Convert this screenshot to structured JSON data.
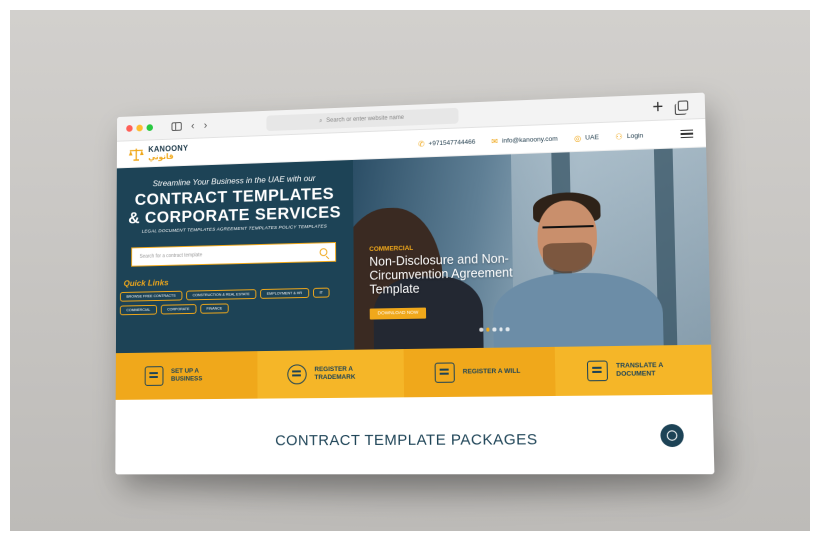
{
  "browser": {
    "address_placeholder": "Search or enter website name",
    "dot_colors": [
      "#ff5f57",
      "#febc2e",
      "#28c840"
    ]
  },
  "header": {
    "logo_en": "KANOONY",
    "logo_ar": "قانوني",
    "phone": "+971547744466",
    "email": "info@kanoony.com",
    "region": "UAE",
    "login": "Login"
  },
  "hero": {
    "subtitle": "Streamline Your Business in the UAE with our",
    "title_line1": "CONTRACT TEMPLATES",
    "title_line2": "& CORPORATE SERVICES",
    "tags": "LEGAL DOCUMENT TEMPLATES   AGREEMENT TEMPLATES   POLICY TEMPLATES",
    "search_placeholder": "Search for a contract template",
    "quick_links_title": "Quick Links",
    "quick_links": [
      "BROWSE FREE CONTRACTS",
      "CONSTRUCTION & REAL ESTATE",
      "EMPLOYMENT & HR",
      "IT",
      "COMMERCIAL",
      "CORPORATE",
      "FINANCE"
    ],
    "slide_tag": "COMMERCIAL",
    "slide_title": "Non-Disclosure and Non-Circumvention Agreement Template",
    "slide_button": "DOWNLOAD NOW"
  },
  "services": [
    {
      "label": "SET UP A BUSINESS",
      "icon": "business-icon"
    },
    {
      "label": "REGISTER A TRADEMARK",
      "icon": "trademark-icon"
    },
    {
      "label": "REGISTER A WILL",
      "icon": "will-icon"
    },
    {
      "label": "TRANSLATE A DOCUMENT",
      "icon": "translate-icon"
    }
  ],
  "packages": {
    "title": "CONTRACT TEMPLATE PACKAGES"
  },
  "colors": {
    "navy": "#1d4356",
    "accent": "#f0a81b"
  }
}
